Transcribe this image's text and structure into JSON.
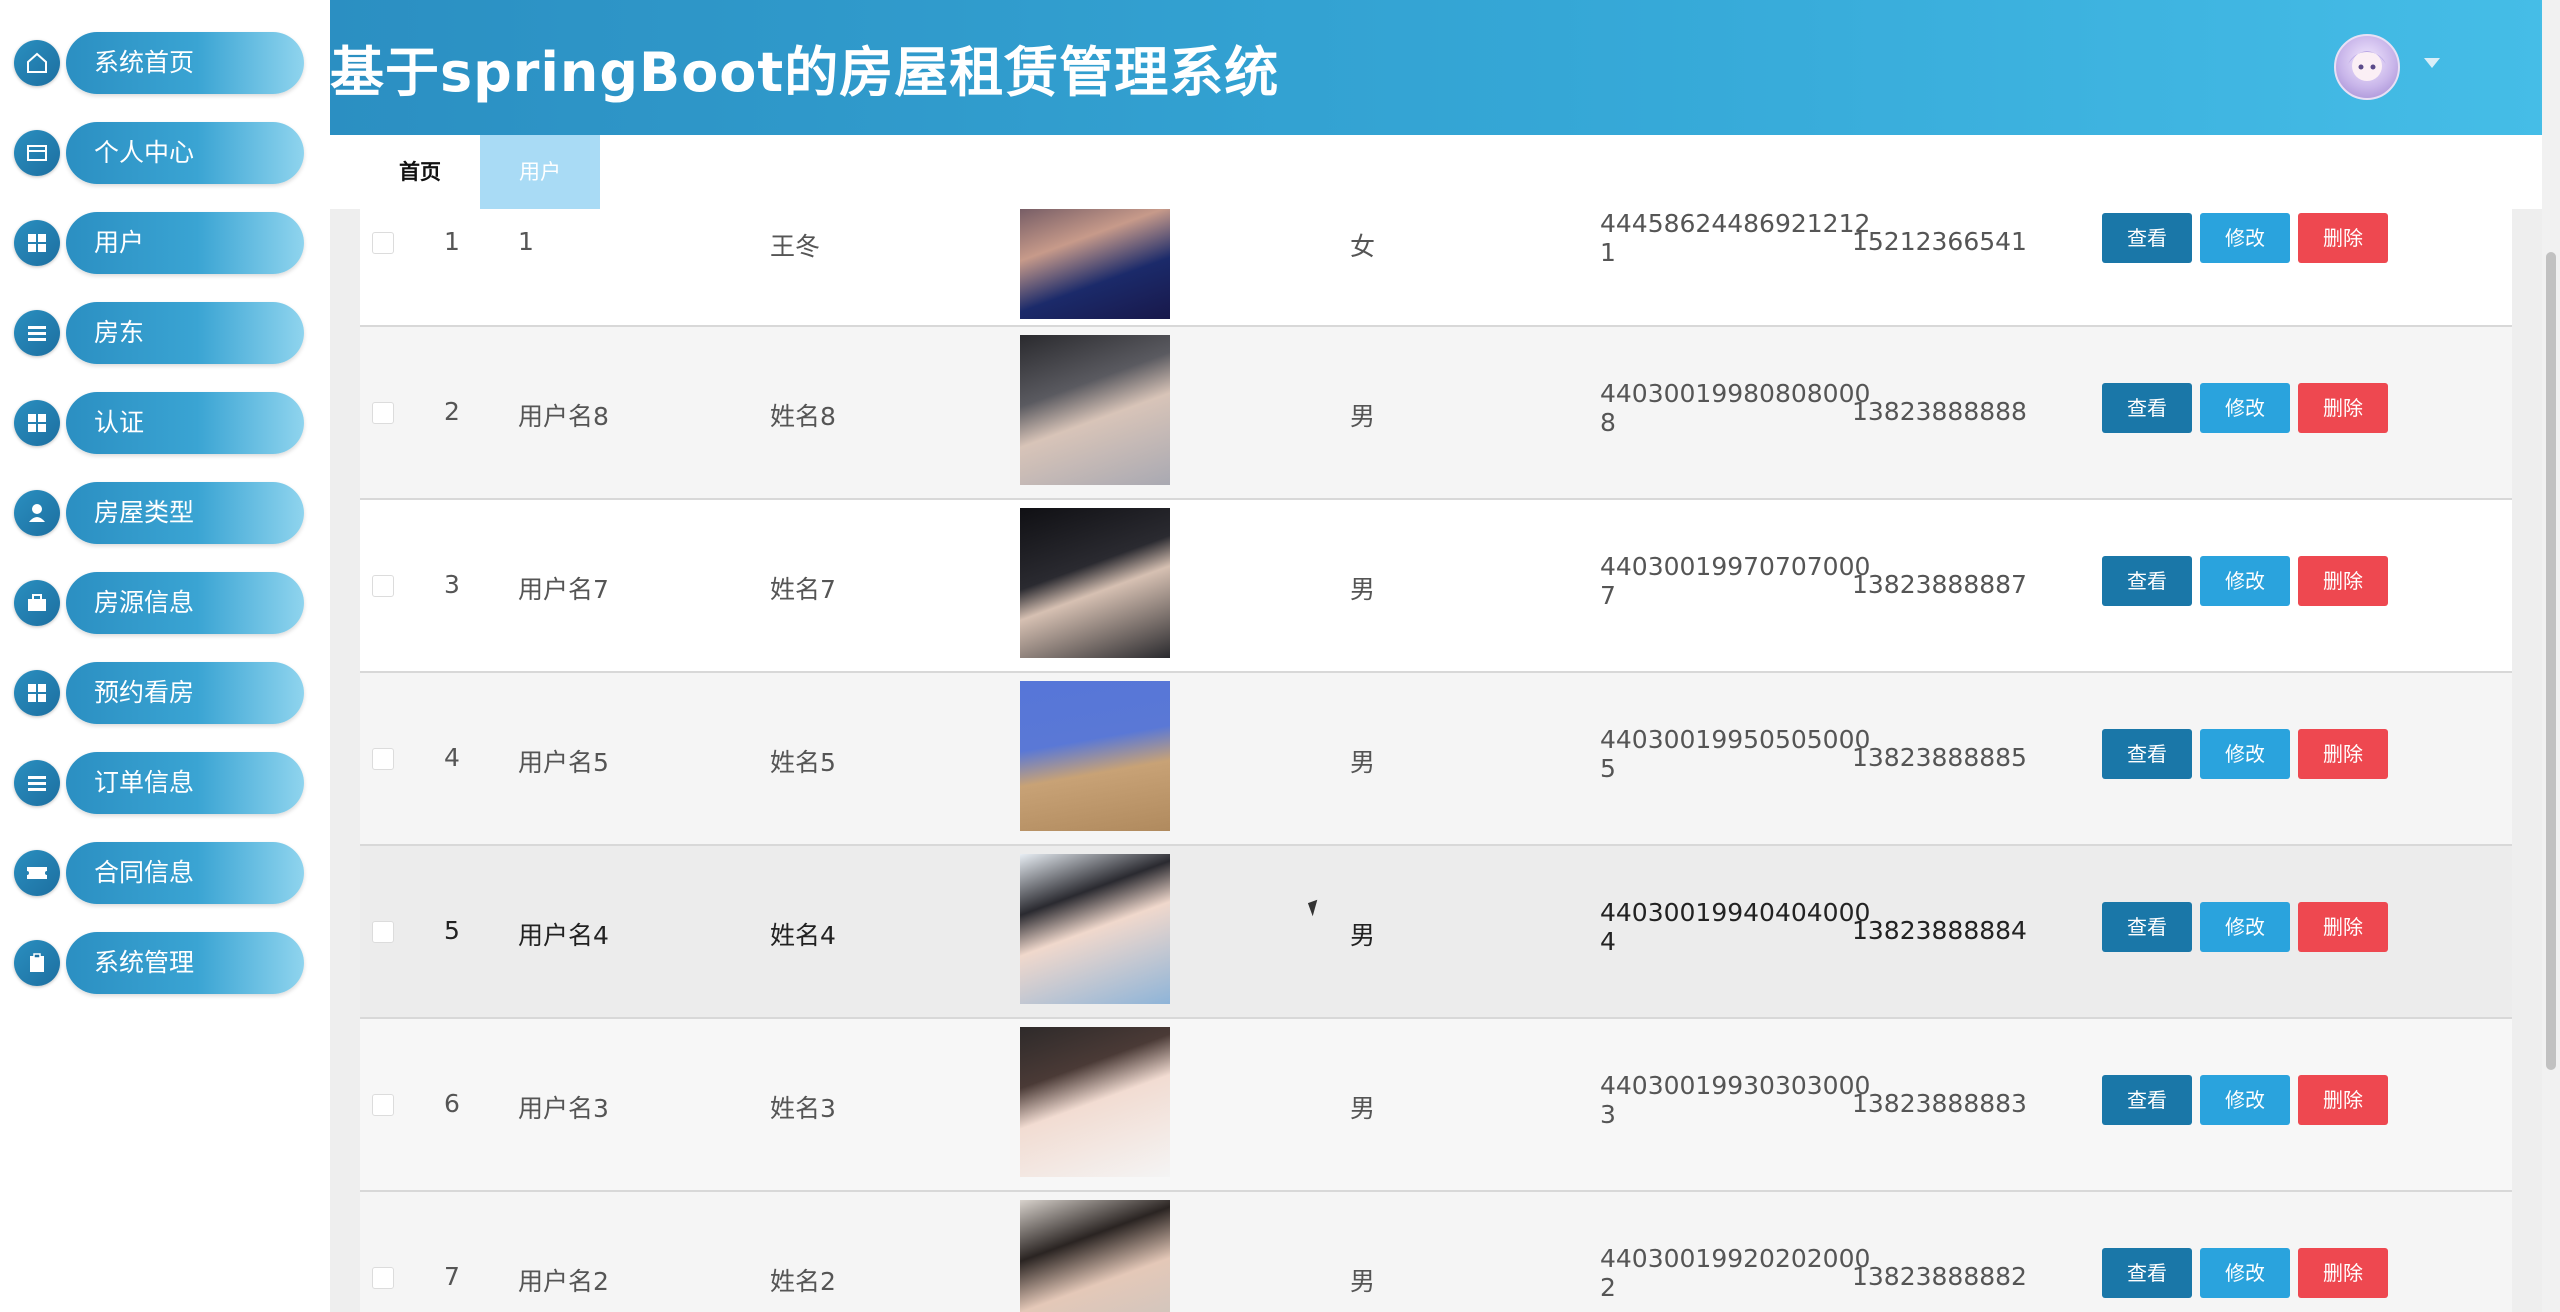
{
  "app": {
    "title": "基于springBoot的房屋租赁管理系统"
  },
  "sidebar": {
    "items": [
      {
        "label": "系统首页",
        "icon": "home-icon"
      },
      {
        "label": "个人中心",
        "icon": "card-icon"
      },
      {
        "label": "用户",
        "icon": "grid-icon"
      },
      {
        "label": "房东",
        "icon": "list-icon"
      },
      {
        "label": "认证",
        "icon": "grid-icon"
      },
      {
        "label": "房屋类型",
        "icon": "person-icon"
      },
      {
        "label": "房源信息",
        "icon": "briefcase-icon"
      },
      {
        "label": "预约看房",
        "icon": "grid-icon"
      },
      {
        "label": "订单信息",
        "icon": "list-icon"
      },
      {
        "label": "合同信息",
        "icon": "ticket-icon"
      },
      {
        "label": "系统管理",
        "icon": "clipboard-icon"
      }
    ]
  },
  "tabs": [
    {
      "label": "首页"
    },
    {
      "label": "用户"
    }
  ],
  "actions": {
    "view": "查看",
    "edit": "修改",
    "delete": "删除"
  },
  "rows": [
    {
      "index": "1",
      "username": "1",
      "name": "王冬",
      "gender": "女",
      "id_line1": "44458624486921212",
      "id_line2": "1",
      "phone": "15212366541"
    },
    {
      "index": "2",
      "username": "用户名8",
      "name": "姓名8",
      "gender": "男",
      "id_line1": "44030019980808000",
      "id_line2": "8",
      "phone": "13823888888"
    },
    {
      "index": "3",
      "username": "用户名7",
      "name": "姓名7",
      "gender": "男",
      "id_line1": "44030019970707000",
      "id_line2": "7",
      "phone": "13823888887"
    },
    {
      "index": "4",
      "username": "用户名5",
      "name": "姓名5",
      "gender": "男",
      "id_line1": "44030019950505000",
      "id_line2": "5",
      "phone": "13823888885"
    },
    {
      "index": "5",
      "username": "用户名4",
      "name": "姓名4",
      "gender": "男",
      "id_line1": "44030019940404000",
      "id_line2": "4",
      "phone": "13823888884"
    },
    {
      "index": "6",
      "username": "用户名3",
      "name": "姓名3",
      "gender": "男",
      "id_line1": "44030019930303000",
      "id_line2": "3",
      "phone": "13823888883"
    },
    {
      "index": "7",
      "username": "用户名2",
      "name": "姓名2",
      "gender": "男",
      "id_line1": "44030019920202000",
      "id_line2": "2",
      "phone": "13823888882"
    }
  ],
  "colors": {
    "header": "#2b8fc2",
    "tab_active": "#a9dbf5",
    "btn_view": "#1a77a8",
    "btn_edit": "#2aa3dd",
    "btn_delete": "#ee4850"
  }
}
